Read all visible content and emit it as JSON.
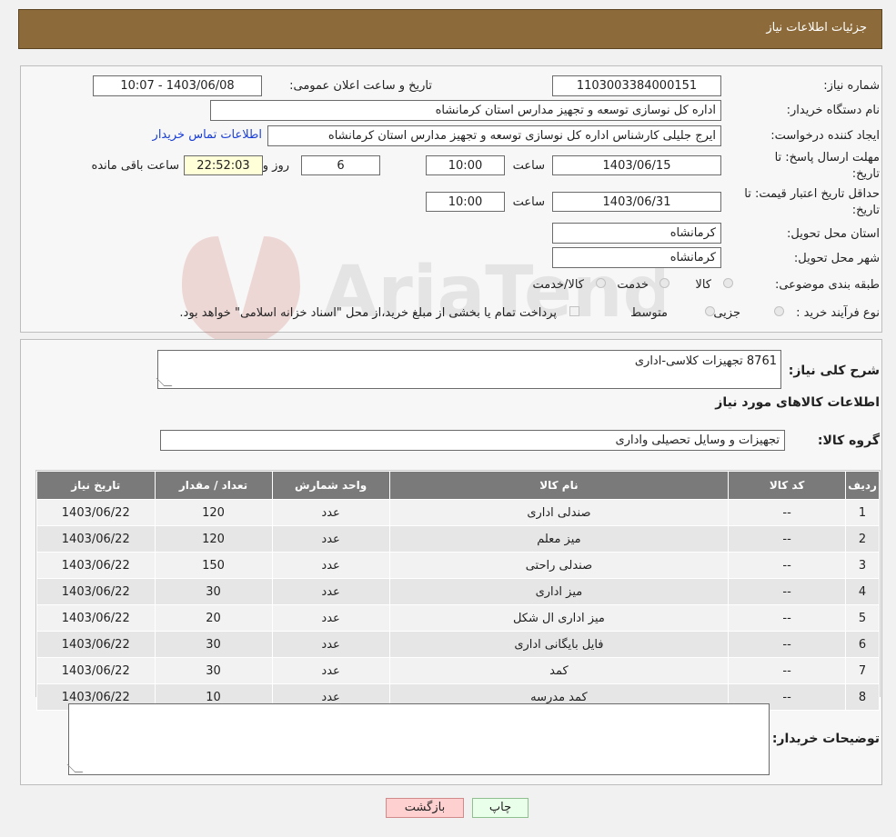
{
  "header": {
    "title": "جزئیات اطلاعات نیاز"
  },
  "form": {
    "need_number_label": "شماره نیاز:",
    "need_number": "1103003384000151",
    "announce_label": "تاریخ و ساعت اعلان عمومی:",
    "announce_value": "1403/06/08 - 10:07",
    "buyer_org_label": "نام دستگاه خریدار:",
    "buyer_org": "اداره کل نوسازی  توسعه و تجهیز مدارس استان کرمانشاه",
    "creator_label": "ایجاد کننده درخواست:",
    "creator": "ایرج جلیلی کارشناس اداره کل نوسازی  توسعه و تجهیز مدارس استان کرمانشاه",
    "contact_link": "اطلاعات تماس خریدار",
    "deadline_label_1": "مهلت ارسال پاسخ: تا",
    "deadline_label_2": "تاریخ:",
    "deadline_date": "1403/06/15",
    "time_label": "ساعت",
    "deadline_time": "10:00",
    "days_value": "6",
    "days_label": "روز و",
    "remaining_time": "22:52:03",
    "remaining_label": "ساعت باقی مانده",
    "validity_label_1": "حداقل تاریخ اعتبار قیمت: تا",
    "validity_label_2": "تاریخ:",
    "validity_date": "1403/06/31",
    "validity_time": "10:00",
    "province_label": "استان محل تحویل:",
    "province": "کرمانشاه",
    "city_label": "شهر محل تحویل:",
    "city": "کرمانشاه",
    "category_label": "طبقه بندی موضوعی:",
    "category_options": [
      "کالا",
      "خدمت",
      "کالا/خدمت"
    ],
    "process_label": "نوع فرآیند خرید :",
    "process_options": [
      "جزیی",
      "متوسط"
    ],
    "payment_note": "پرداخت تمام یا بخشی از مبلغ خرید،از محل \"اسناد خزانه اسلامی\" خواهد بود."
  },
  "description": {
    "label": "شرح کلی نیاز:",
    "value": "8761 تجهیزات کلاسی-اداری"
  },
  "goods": {
    "section_title": "اطلاعات کالاهای مورد نیاز",
    "group_label": "گروه کالا:",
    "group_value": "تجهیزات و وسایل تحصیلی واداری",
    "columns": [
      "ردیف",
      "کد کالا",
      "نام کالا",
      "واحد شمارش",
      "تعداد / مقدار",
      "تاریخ نیاز"
    ],
    "rows": [
      [
        "1",
        "--",
        "صندلی اداری",
        "عدد",
        "120",
        "1403/06/22"
      ],
      [
        "2",
        "--",
        "میز معلم",
        "عدد",
        "120",
        "1403/06/22"
      ],
      [
        "3",
        "--",
        "صندلی راحتی",
        "عدد",
        "150",
        "1403/06/22"
      ],
      [
        "4",
        "--",
        "میز اداری",
        "عدد",
        "30",
        "1403/06/22"
      ],
      [
        "5",
        "--",
        "میز اداری ال شکل",
        "عدد",
        "20",
        "1403/06/22"
      ],
      [
        "6",
        "--",
        "فایل بایگانی اداری",
        "عدد",
        "30",
        "1403/06/22"
      ],
      [
        "7",
        "--",
        "کمد",
        "عدد",
        "30",
        "1403/06/22"
      ],
      [
        "8",
        "--",
        "کمد مدرسه",
        "عدد",
        "10",
        "1403/06/22"
      ]
    ]
  },
  "buyer_notes": {
    "label": "توضیحات خریدار:"
  },
  "buttons": {
    "print": "چاپ",
    "back": "بازگشت"
  },
  "colors": {
    "header": "#8c6a3a",
    "table_header": "#7a7a7a",
    "link": "#1a3fd8",
    "back_button": "#ffd0d0",
    "print_button": "#eaffea"
  }
}
